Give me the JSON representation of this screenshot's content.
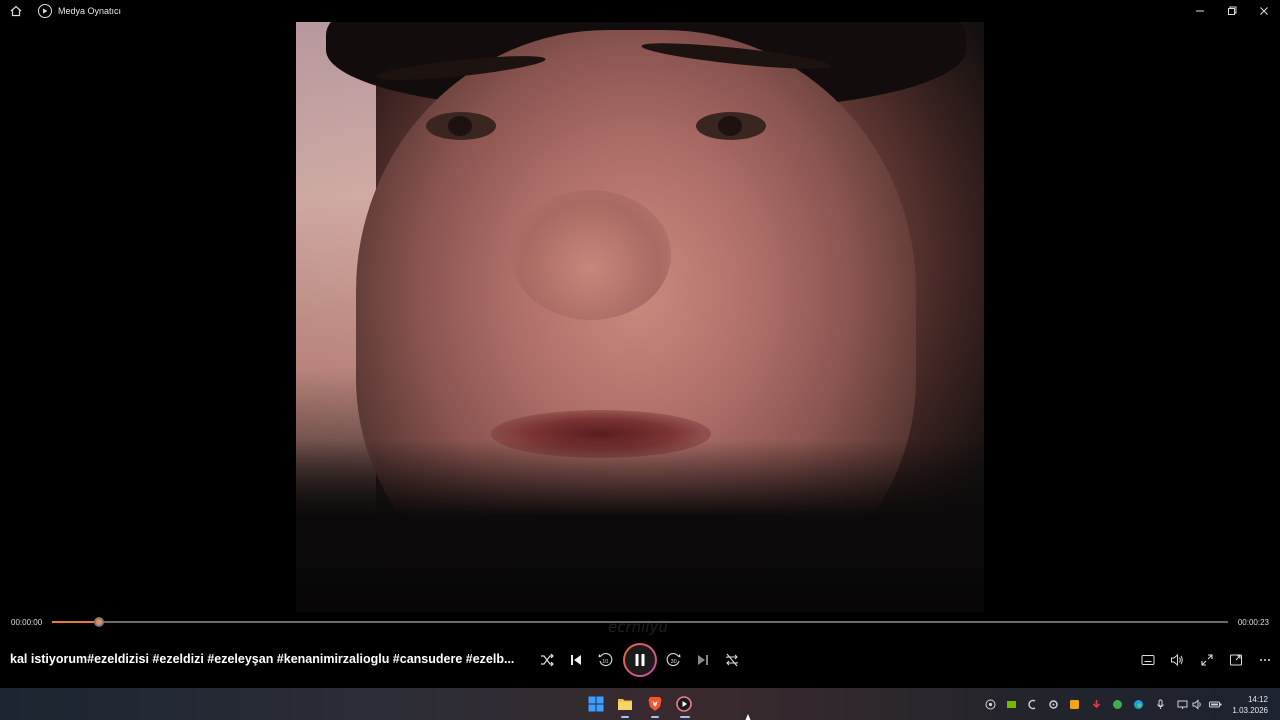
{
  "window": {
    "title": "Medya Oynatıcı",
    "home_icon": "home-icon",
    "app_icon": "media-player-icon",
    "controls": [
      "minimize-icon",
      "restore-icon",
      "close-icon"
    ]
  },
  "video": {
    "watermark": "ecrnilyü"
  },
  "playback": {
    "current_time": "00:00:00",
    "duration": "00:00:23",
    "progress_fraction": 0.04,
    "accent_color": "#e87a3e"
  },
  "controls": {
    "media_title": "kal istiyorum#ezeldizisi #ezeldizi #ezeleyşan #kenanimirzalioglu #cansudere #ezelb...",
    "center_icons": [
      "shuffle-icon",
      "previous-icon",
      "rewind-10-icon",
      "pause-icon",
      "forward-30-icon",
      "next-icon",
      "repeat-off-icon"
    ],
    "right_icons": [
      "captions-icon",
      "volume-icon",
      "fullscreen-icon",
      "miniplayer-icon",
      "more-icon"
    ],
    "skip_back_label": "10",
    "skip_forward_label": "30"
  },
  "taskbar": {
    "pinned": [
      "windows-start-icon",
      "file-explorer-icon",
      "brave-browser-icon",
      "media-player-icon"
    ],
    "tray": [
      "steam-icon",
      "nvidia-icon",
      "app-icon",
      "settings-icon",
      "antivirus-icon",
      "download-icon",
      "xbox-icon",
      "edge-icon",
      "microphone-icon",
      "network-icon",
      "speaker-icon",
      "battery-icon"
    ],
    "time": "14:12",
    "date": "1.03.2026"
  }
}
